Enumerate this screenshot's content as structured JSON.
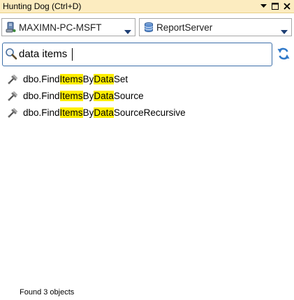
{
  "window": {
    "title": "Hunting Dog (Ctrl+D)",
    "controls": [
      {
        "name": "window-position-menu-icon",
        "glyph": "▾"
      },
      {
        "name": "maximize-icon",
        "glyph": "□"
      },
      {
        "name": "close-icon",
        "glyph": "✕"
      }
    ]
  },
  "selectors": {
    "server": {
      "value": "MAXIMN-PC-MSFT",
      "icon": "server-icon"
    },
    "database": {
      "value": "ReportServer",
      "icon": "database-icon"
    }
  },
  "search": {
    "value": "data items",
    "icon": "magnifier-icon",
    "refresh_icon": "refresh-icon"
  },
  "results": [
    {
      "full_text": "dbo.FindItemsByDataSet",
      "segments": [
        {
          "text": "dbo.Find",
          "highlight": false
        },
        {
          "text": "Items",
          "highlight": true
        },
        {
          "text": "By",
          "highlight": false
        },
        {
          "text": "Data",
          "highlight": true
        },
        {
          "text": "Set",
          "highlight": false
        }
      ],
      "icon": "stored-procedure-icon"
    },
    {
      "full_text": "dbo.FindItemsByDataSource",
      "segments": [
        {
          "text": "dbo.Find",
          "highlight": false
        },
        {
          "text": "Items",
          "highlight": true
        },
        {
          "text": "By",
          "highlight": false
        },
        {
          "text": "Data",
          "highlight": true
        },
        {
          "text": "Source",
          "highlight": false
        }
      ],
      "icon": "stored-procedure-icon"
    },
    {
      "full_text": "dbo.FindItemsByDataSourceRecursive",
      "segments": [
        {
          "text": "dbo.Find",
          "highlight": false
        },
        {
          "text": "Items",
          "highlight": true
        },
        {
          "text": "By",
          "highlight": false
        },
        {
          "text": "Data",
          "highlight": true
        },
        {
          "text": "SourceRecursive",
          "highlight": false
        }
      ],
      "icon": "stored-procedure-icon"
    }
  ],
  "status": {
    "text": "Found 3 objects"
  },
  "colors": {
    "title_bar": "#fcecc0",
    "highlight": "#ffee00",
    "search_border": "#3b6ea8"
  }
}
